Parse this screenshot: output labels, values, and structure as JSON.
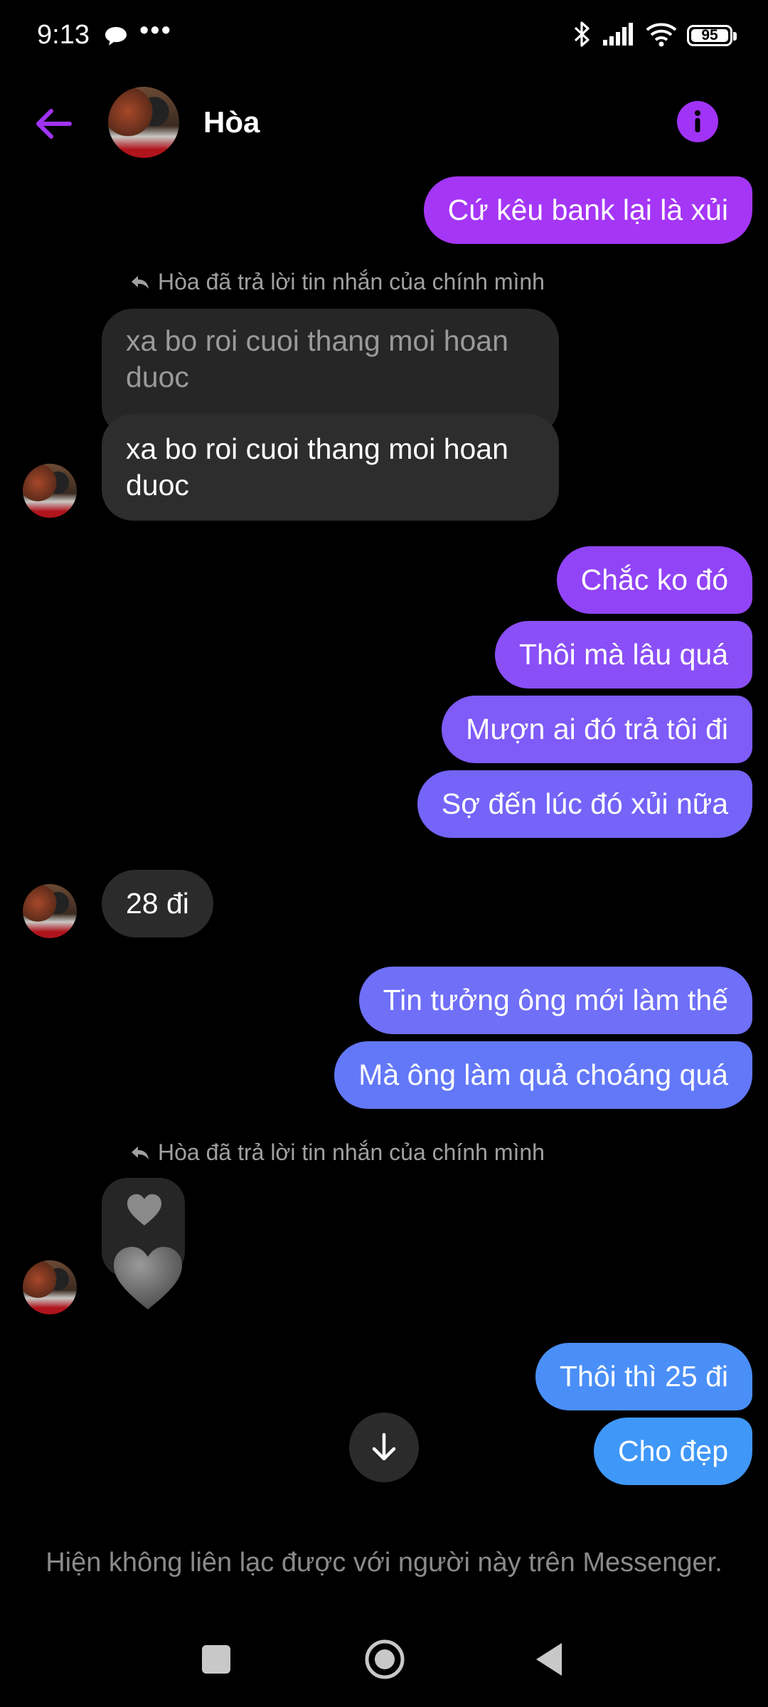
{
  "status_bar": {
    "time": "9:13",
    "dots": "•••",
    "battery": "95"
  },
  "header": {
    "contact_name": "Hòa"
  },
  "messages": {
    "m1": "Cứ kêu bank lại là xủi",
    "reply_note_1": "Hòa đã trả lời tin nhắn của chính mình",
    "quoted_1": "xa bo roi cuoi thang moi hoan duoc",
    "reply_1": "xa bo roi cuoi thang moi hoan duoc",
    "m2": "Chắc ko đó",
    "m3": "Thôi mà lâu quá",
    "m4": "Mượn ai đó trả tôi đi",
    "m5": "Sợ đến lúc đó xủi nữa",
    "in_1": "28 đi",
    "m6": "Tin tưởng ông mới làm thế",
    "m7": "Mà ông làm quả choáng quá",
    "reply_note_2": "Hòa đã trả lời tin nhắn của chính mình",
    "m8": "Thôi thì  25 đi",
    "m9": "Cho đẹp"
  },
  "footer": {
    "unavailable_text": "Hiện không liên lạc được với người này trên Messenger."
  },
  "colors": {
    "accent": "#a033f5",
    "bubble_gradient": [
      "#a536f6",
      "#8a4ff7",
      "#6f6ff8",
      "#4a8ff8",
      "#3f97f8"
    ],
    "incoming_bubble": "#2b2b2b"
  },
  "icons": [
    "back-arrow-icon",
    "info-icon",
    "bluetooth-icon",
    "signal-icon",
    "wifi-icon",
    "battery-icon",
    "reply-arrow-icon",
    "heart-icon",
    "arrow-down-icon"
  ]
}
